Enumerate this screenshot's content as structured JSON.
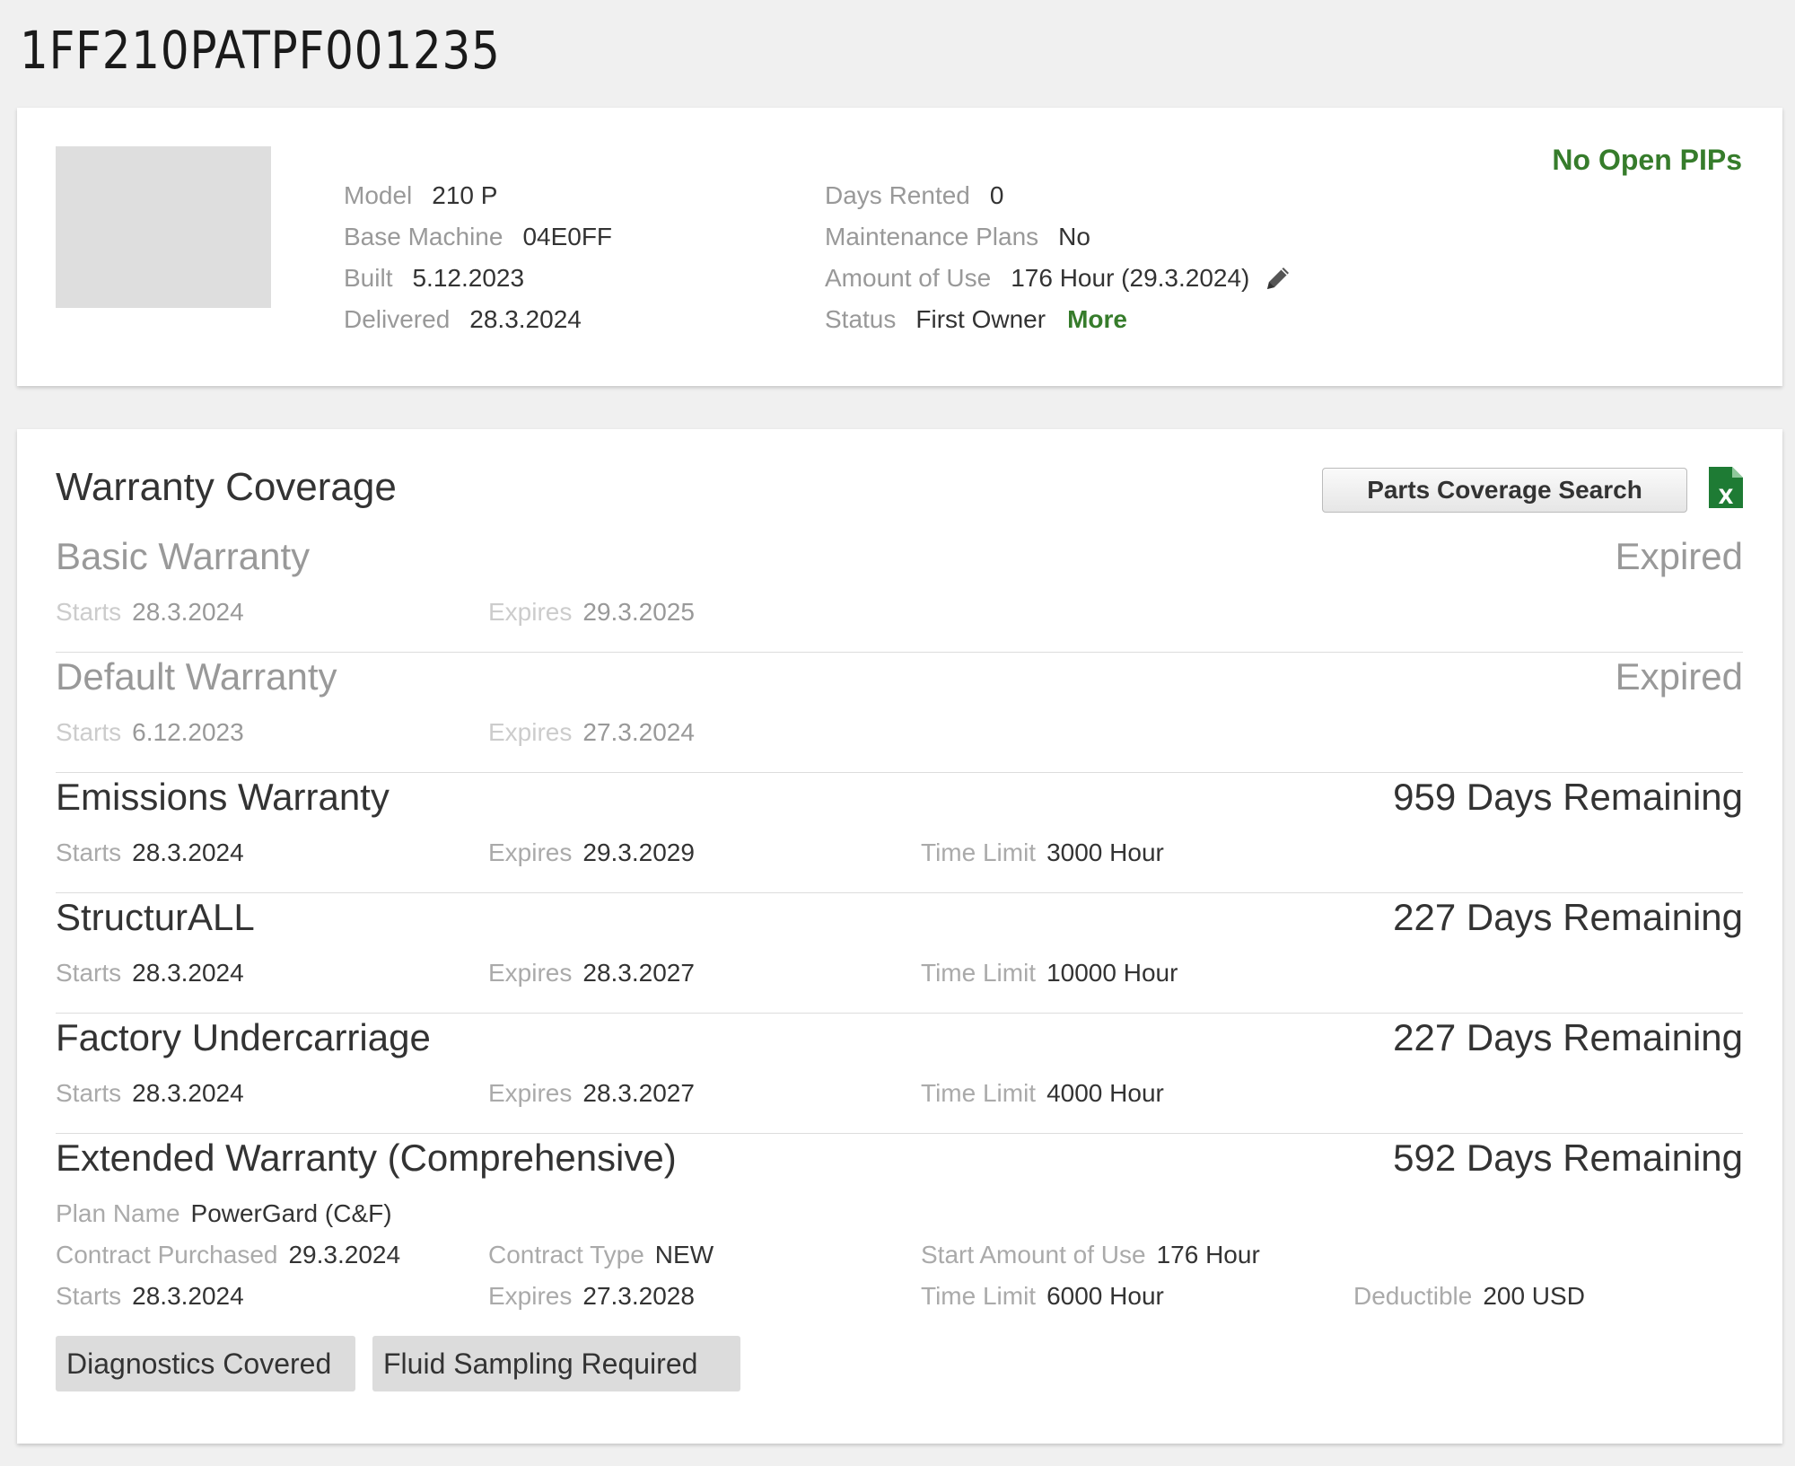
{
  "machine": {
    "serial": "1FF210PATPF001235",
    "model_label": "Model",
    "model": "210 P",
    "base_label": "Base Machine",
    "base": "04E0FF",
    "built_label": "Built",
    "built": "5.12.2023",
    "delivered_label": "Delivered",
    "delivered": "28.3.2024",
    "days_rented_label": "Days Rented",
    "days_rented": "0",
    "maint_label": "Maintenance Plans",
    "maint": "No",
    "use_label": "Amount of Use",
    "use": "176 Hour (29.3.2024)",
    "status_label": "Status",
    "status": "First Owner",
    "more": "More",
    "pips": "No Open PIPs"
  },
  "warranty": {
    "title": "Warranty Coverage",
    "parts_button": "Parts Coverage Search",
    "sections": [
      {
        "name": "Basic Warranty",
        "status": "Expired",
        "starts_label": "Starts",
        "starts": "28.3.2024",
        "expires_label": "Expires",
        "expires": "29.3.2025"
      },
      {
        "name": "Default Warranty",
        "status": "Expired",
        "starts_label": "Starts",
        "starts": "6.12.2023",
        "expires_label": "Expires",
        "expires": "27.3.2024"
      },
      {
        "name": "Emissions Warranty",
        "status": "959 Days Remaining",
        "starts_label": "Starts",
        "starts": "28.3.2024",
        "expires_label": "Expires",
        "expires": "29.3.2029",
        "limit_label": "Time Limit",
        "limit": "3000 Hour"
      },
      {
        "name": "StructurALL",
        "status": "227 Days Remaining",
        "starts_label": "Starts",
        "starts": "28.3.2024",
        "expires_label": "Expires",
        "expires": "28.3.2027",
        "limit_label": "Time Limit",
        "limit": "10000 Hour"
      },
      {
        "name": "Factory Undercarriage",
        "status": "227 Days Remaining",
        "starts_label": "Starts",
        "starts": "28.3.2024",
        "expires_label": "Expires",
        "expires": "28.3.2027",
        "limit_label": "Time Limit",
        "limit": "4000 Hour"
      }
    ],
    "extended": {
      "name": "Extended Warranty (Comprehensive)",
      "status": "592 Days Remaining",
      "plan_label": "Plan Name",
      "plan": "PowerGard (C&F)",
      "purchased_label": "Contract Purchased",
      "purchased": "29.3.2024",
      "type_label": "Contract Type",
      "type": "NEW",
      "start_use_label": "Start Amount of Use",
      "start_use": "176 Hour",
      "starts_label": "Starts",
      "starts": "28.3.2024",
      "expires_label": "Expires",
      "expires": "27.3.2028",
      "limit_label": "Time Limit",
      "limit": "6000 Hour",
      "deductible_label": "Deductible",
      "deductible": "200 USD",
      "tags": [
        "Diagnostics Covered",
        "Fluid Sampling Required"
      ]
    }
  },
  "colors": {
    "accent_green": "#367c2b",
    "muted": "#999999",
    "background": "#f0f0f0"
  },
  "icons": {
    "edit": "pencil-icon",
    "export": "excel-icon"
  }
}
